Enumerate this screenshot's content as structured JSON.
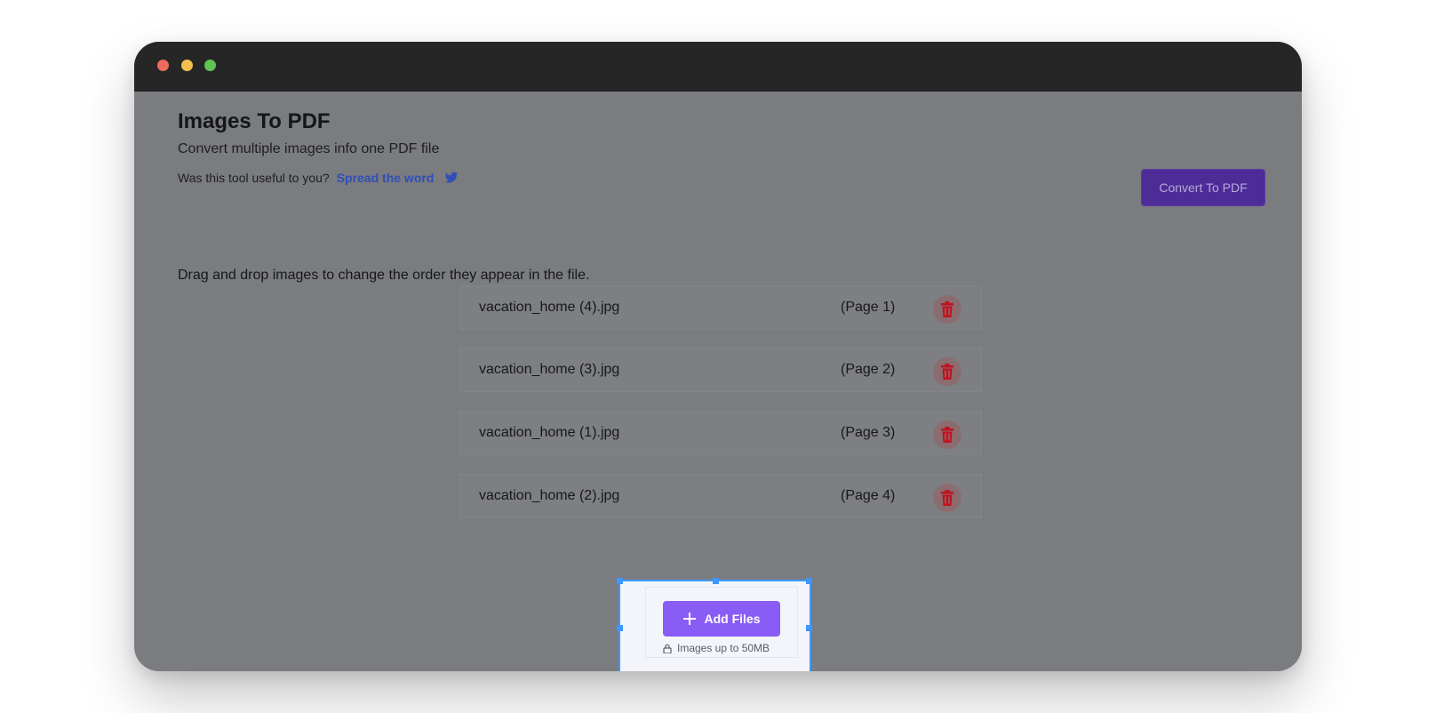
{
  "header": {
    "title": "Images To PDF",
    "subtitle": "Convert multiple images info one PDF file",
    "useful_text": "Was this tool useful to you?",
    "spread_link": "Spread the word",
    "convert_label": "Convert To PDF"
  },
  "instruction": "Drag and drop images to change the order they appear in the file.",
  "files": [
    {
      "name": "vacation_home (4).jpg",
      "page": "(Page 1)"
    },
    {
      "name": "vacation_home (3).jpg",
      "page": "(Page 2)"
    },
    {
      "name": "vacation_home (1).jpg",
      "page": "(Page 3)"
    },
    {
      "name": "vacation_home (2).jpg",
      "page": "(Page 4)"
    }
  ],
  "dropzone": {
    "add_label": "Add Files",
    "note": "Images up to 50MB"
  },
  "icons": {
    "delete": "trash-icon",
    "twitter": "twitter-icon",
    "plus": "plus-icon",
    "lock": "lock-icon"
  },
  "colors": {
    "accent": "#8a5cf6",
    "convert_button": "#4d2c98",
    "link": "#2f4fb8",
    "delete": "#c1121f",
    "selection": "#3d97ff"
  }
}
